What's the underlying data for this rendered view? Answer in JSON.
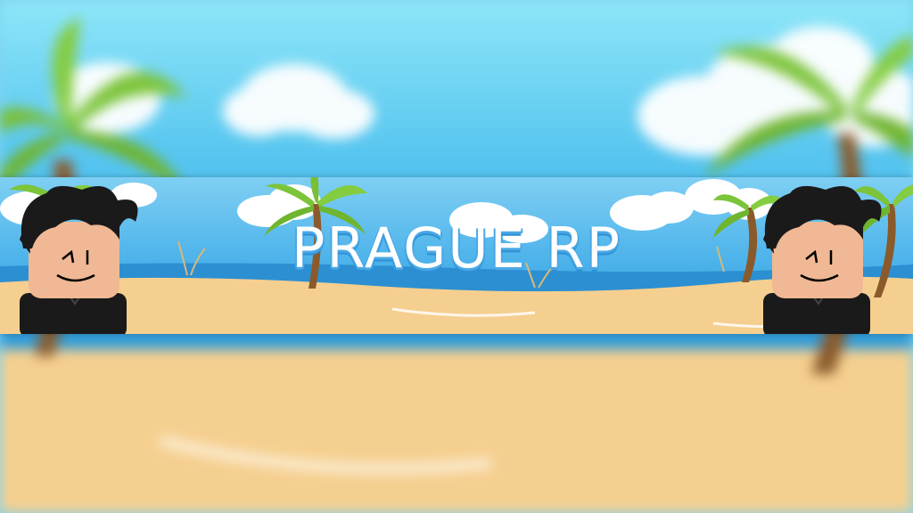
{
  "banner": {
    "title": "PRAGUE RP"
  },
  "colors": {
    "sky_top": "#8ee6f8",
    "sky_bottom": "#3aa9e3",
    "sand": "#f5cf8f",
    "sea": "#2f9ad8",
    "palm_leaf": "#7cc43a",
    "palm_trunk": "#8a5a2b",
    "title_text": "#ffffff",
    "title_outline": "#4aa8e6"
  },
  "icons": [
    "palm-tree-icon",
    "cloud-icon",
    "avatar-character-icon"
  ]
}
